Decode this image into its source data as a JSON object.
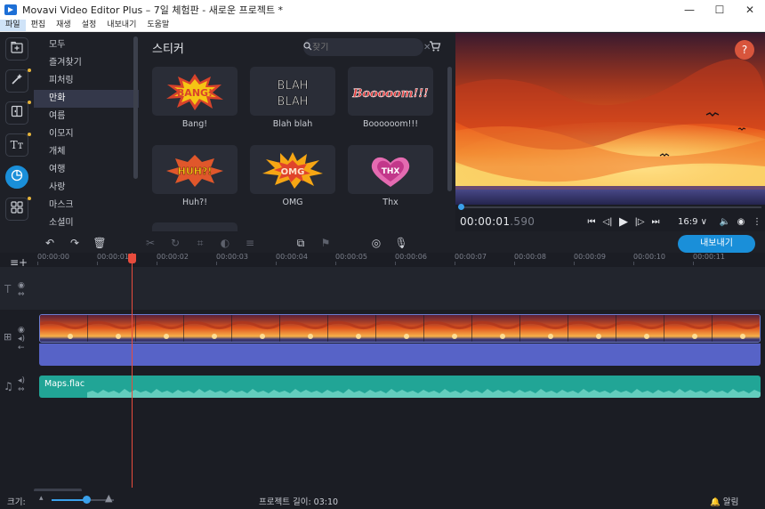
{
  "window": {
    "title": "Movavi Video Editor Plus – 7일 체험판 - 새로운 프로젝트 *",
    "minimize": "—",
    "maximize": "☐",
    "close": "✕"
  },
  "menu": [
    "파일",
    "편집",
    "재생",
    "설정",
    "내보내기",
    "도움말"
  ],
  "rail": [
    {
      "icon": "import-icon",
      "glyph": "⊞",
      "dot": false
    },
    {
      "icon": "magic-wand-icon",
      "glyph": "✦",
      "dot": true
    },
    {
      "icon": "transitions-icon",
      "glyph": "⧉",
      "dot": true
    },
    {
      "icon": "titles-icon",
      "glyph": "Tт",
      "dot": true
    },
    {
      "icon": "stickers-icon",
      "glyph": "◔",
      "dot": false
    },
    {
      "icon": "more-tools-icon",
      "glyph": "⊞",
      "dot": true
    }
  ],
  "categories": [
    "모두",
    "즐겨찾기",
    "피처링",
    "만화",
    "여름",
    "이모지",
    "개체",
    "여행",
    "사랑",
    "마스크",
    "소셜미"
  ],
  "active_category": 3,
  "stickers": {
    "title": "스티커",
    "search_placeholder": "찾기",
    "items": [
      {
        "label": "Bang!",
        "art": "BANG!",
        "color": "#f2c40f"
      },
      {
        "label": "Blah blah",
        "art": "BLAH BLAH",
        "color": "#ffffff"
      },
      {
        "label": "Boooooom!!!",
        "art": "Booooom!!!",
        "color": "#e03a3a"
      },
      {
        "label": "Huh?!",
        "art": "HUH?!",
        "color": "#f2a20f"
      },
      {
        "label": "OMG",
        "art": "OMG",
        "color": "#ef6a3a"
      },
      {
        "label": "Thx",
        "art": "THX",
        "color": "#e46bb1"
      }
    ]
  },
  "preview": {
    "help": "?",
    "timecode_main": "00:00:01",
    "timecode_ms": ".590",
    "aspect": "16:9 ∨",
    "progress": 0.0
  },
  "toolbar": {
    "export_label": "내보내기"
  },
  "ruler": [
    "00:00:00",
    "00:00:01",
    "00:00:02",
    "00:00:03",
    "00:00:04",
    "00:00:05",
    "00:00:06",
    "00:00:07",
    "00:00:08",
    "00:00:09",
    "00:00:10",
    "00:00:11"
  ],
  "audio": {
    "clip_name": "Maps.flac"
  },
  "status": {
    "zoom_label": "크기:",
    "zoom_level": 0.55,
    "project_length": "프로젝트 길이:  03:10",
    "alerts": "알림"
  }
}
